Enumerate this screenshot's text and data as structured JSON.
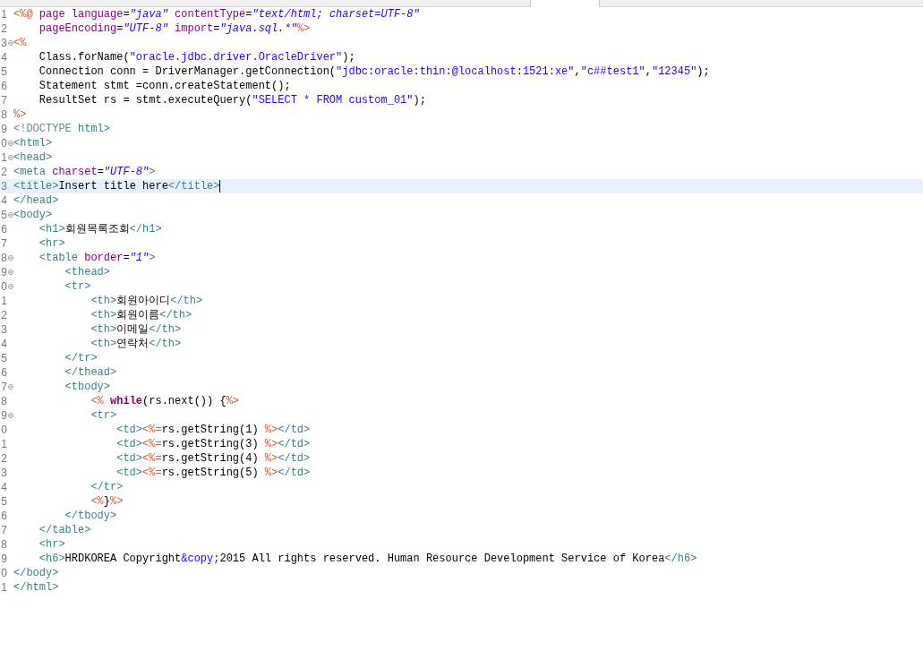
{
  "editor": {
    "lines": [
      {
        "number": "1",
        "fold": false,
        "current": false,
        "tokens": [
          {
            "kind": "jsp",
            "text": "<%@ "
          },
          {
            "kind": "attr",
            "text": "page "
          },
          {
            "kind": "attr",
            "text": "language"
          },
          {
            "kind": "text",
            "text": "="
          },
          {
            "kind": "value",
            "text": "\"java\" "
          },
          {
            "kind": "attr",
            "text": "contentType"
          },
          {
            "kind": "text",
            "text": "="
          },
          {
            "kind": "value",
            "text": "\"text/html; charset=UTF-8\""
          }
        ]
      },
      {
        "number": "2",
        "fold": false,
        "current": false,
        "tokens": [
          {
            "kind": "attr",
            "text": "    pageEncoding"
          },
          {
            "kind": "text",
            "text": "="
          },
          {
            "kind": "value",
            "text": "\"UTF-8\" "
          },
          {
            "kind": "attr",
            "text": "import"
          },
          {
            "kind": "text",
            "text": "="
          },
          {
            "kind": "value",
            "text": "\"java.sql.*\""
          },
          {
            "kind": "jsp",
            "text": "%>"
          }
        ]
      },
      {
        "number": "3",
        "fold": true,
        "current": false,
        "tokens": [
          {
            "kind": "jsp",
            "text": "<%"
          }
        ]
      },
      {
        "number": "4",
        "fold": false,
        "current": false,
        "tokens": [
          {
            "kind": "text",
            "text": "    Class.forName("
          },
          {
            "kind": "string",
            "text": "\"oracle.jdbc.driver.OracleDriver\""
          },
          {
            "kind": "text",
            "text": ");"
          }
        ]
      },
      {
        "number": "5",
        "fold": false,
        "current": false,
        "tokens": [
          {
            "kind": "text",
            "text": "    Connection conn = DriverManager.getConnection("
          },
          {
            "kind": "string",
            "text": "\"jdbc:oracle:thin:@localhost:1521:xe\""
          },
          {
            "kind": "text",
            "text": ","
          },
          {
            "kind": "string",
            "text": "\"c##test1\""
          },
          {
            "kind": "text",
            "text": ","
          },
          {
            "kind": "string",
            "text": "\"12345\""
          },
          {
            "kind": "text",
            "text": ");"
          }
        ]
      },
      {
        "number": "6",
        "fold": false,
        "current": false,
        "tokens": [
          {
            "kind": "text",
            "text": "    Statement stmt =conn.createStatement();"
          }
        ]
      },
      {
        "number": "7",
        "fold": false,
        "current": false,
        "tokens": [
          {
            "kind": "text",
            "text": "    ResultSet rs = stmt.executeQuery("
          },
          {
            "kind": "string",
            "text": "\"SELECT * FROM custom_01\""
          },
          {
            "kind": "text",
            "text": ");"
          }
        ]
      },
      {
        "number": "8",
        "fold": false,
        "current": false,
        "tokens": [
          {
            "kind": "jsp",
            "text": "%>"
          }
        ]
      },
      {
        "number": "9",
        "fold": false,
        "current": false,
        "tokens": [
          {
            "kind": "doctype",
            "text": "<!DOCTYPE"
          },
          {
            "kind": "tag",
            "text": " html>"
          }
        ]
      },
      {
        "number": "0",
        "fold": true,
        "current": false,
        "tokens": [
          {
            "kind": "tag",
            "text": "<html>"
          }
        ]
      },
      {
        "number": "1",
        "fold": true,
        "current": false,
        "tokens": [
          {
            "kind": "tag",
            "text": "<head>"
          }
        ]
      },
      {
        "number": "2",
        "fold": false,
        "current": false,
        "tokens": [
          {
            "kind": "tag",
            "text": "<meta "
          },
          {
            "kind": "attr",
            "text": "charset"
          },
          {
            "kind": "text",
            "text": "="
          },
          {
            "kind": "value",
            "text": "\"UTF-8\""
          },
          {
            "kind": "tag",
            "text": ">"
          }
        ]
      },
      {
        "number": "3",
        "fold": false,
        "current": true,
        "tokens": [
          {
            "kind": "tag",
            "text": "<title>"
          },
          {
            "kind": "text",
            "text": "Insert title here"
          },
          {
            "kind": "tag",
            "text": "</title>"
          }
        ]
      },
      {
        "number": "4",
        "fold": false,
        "current": false,
        "tokens": [
          {
            "kind": "tag",
            "text": "</head>"
          }
        ]
      },
      {
        "number": "5",
        "fold": true,
        "current": false,
        "tokens": [
          {
            "kind": "tag",
            "text": "<body>"
          }
        ]
      },
      {
        "number": "6",
        "fold": false,
        "current": false,
        "tokens": [
          {
            "kind": "tag",
            "text": "    <h1>"
          },
          {
            "kind": "text",
            "text": "회원목록조회"
          },
          {
            "kind": "tag",
            "text": "</h1>"
          }
        ]
      },
      {
        "number": "7",
        "fold": false,
        "current": false,
        "tokens": [
          {
            "kind": "tag",
            "text": "    <hr>"
          }
        ]
      },
      {
        "number": "8",
        "fold": true,
        "current": false,
        "tokens": [
          {
            "kind": "tag",
            "text": "    <table "
          },
          {
            "kind": "attr",
            "text": "border"
          },
          {
            "kind": "text",
            "text": "="
          },
          {
            "kind": "value",
            "text": "\"1\""
          },
          {
            "kind": "tag",
            "text": ">"
          }
        ]
      },
      {
        "number": "9",
        "fold": true,
        "current": false,
        "tokens": [
          {
            "kind": "tag",
            "text": "        <thead>"
          }
        ]
      },
      {
        "number": "0",
        "fold": true,
        "current": false,
        "tokens": [
          {
            "kind": "tag",
            "text": "        <tr>"
          }
        ]
      },
      {
        "number": "1",
        "fold": false,
        "current": false,
        "tokens": [
          {
            "kind": "tag",
            "text": "            <th>"
          },
          {
            "kind": "text",
            "text": "회원아이디"
          },
          {
            "kind": "tag",
            "text": "</th>"
          }
        ]
      },
      {
        "number": "2",
        "fold": false,
        "current": false,
        "tokens": [
          {
            "kind": "tag",
            "text": "            <th>"
          },
          {
            "kind": "text",
            "text": "회원이름"
          },
          {
            "kind": "tag",
            "text": "</th>"
          }
        ]
      },
      {
        "number": "3",
        "fold": false,
        "current": false,
        "tokens": [
          {
            "kind": "tag",
            "text": "            <th>"
          },
          {
            "kind": "text",
            "text": "이메일"
          },
          {
            "kind": "tag",
            "text": "</th>"
          }
        ]
      },
      {
        "number": "4",
        "fold": false,
        "current": false,
        "tokens": [
          {
            "kind": "tag",
            "text": "            <th>"
          },
          {
            "kind": "text",
            "text": "연락처"
          },
          {
            "kind": "tag",
            "text": "</th>"
          }
        ]
      },
      {
        "number": "5",
        "fold": false,
        "current": false,
        "tokens": [
          {
            "kind": "tag",
            "text": "        </tr>"
          }
        ]
      },
      {
        "number": "6",
        "fold": false,
        "current": false,
        "tokens": [
          {
            "kind": "tag",
            "text": "        </thead>"
          }
        ]
      },
      {
        "number": "7",
        "fold": true,
        "current": false,
        "tokens": [
          {
            "kind": "tag",
            "text": "        <tbody>"
          }
        ]
      },
      {
        "number": "8",
        "fold": false,
        "current": false,
        "tokens": [
          {
            "kind": "jsp",
            "text": "            <% "
          },
          {
            "kind": "keyword",
            "text": "while"
          },
          {
            "kind": "text",
            "text": "(rs.next()) {"
          },
          {
            "kind": "jsp",
            "text": "%>"
          }
        ]
      },
      {
        "number": "9",
        "fold": true,
        "current": false,
        "tokens": [
          {
            "kind": "tag",
            "text": "            <tr>"
          }
        ]
      },
      {
        "number": "0",
        "fold": false,
        "current": false,
        "tokens": [
          {
            "kind": "tag",
            "text": "                <td>"
          },
          {
            "kind": "jsp",
            "text": "<%="
          },
          {
            "kind": "text",
            "text": "rs.getString(1) "
          },
          {
            "kind": "jsp",
            "text": "%>"
          },
          {
            "kind": "tag",
            "text": "</td>"
          }
        ]
      },
      {
        "number": "1",
        "fold": false,
        "current": false,
        "tokens": [
          {
            "kind": "tag",
            "text": "                <td>"
          },
          {
            "kind": "jsp",
            "text": "<%="
          },
          {
            "kind": "text",
            "text": "rs.getString(3) "
          },
          {
            "kind": "jsp",
            "text": "%>"
          },
          {
            "kind": "tag",
            "text": "</td>"
          }
        ]
      },
      {
        "number": "2",
        "fold": false,
        "current": false,
        "tokens": [
          {
            "kind": "tag",
            "text": "                <td>"
          },
          {
            "kind": "jsp",
            "text": "<%="
          },
          {
            "kind": "text",
            "text": "rs.getString(4) "
          },
          {
            "kind": "jsp",
            "text": "%>"
          },
          {
            "kind": "tag",
            "text": "</td>"
          }
        ]
      },
      {
        "number": "3",
        "fold": false,
        "current": false,
        "tokens": [
          {
            "kind": "tag",
            "text": "                <td>"
          },
          {
            "kind": "jsp",
            "text": "<%="
          },
          {
            "kind": "text",
            "text": "rs.getString(5) "
          },
          {
            "kind": "jsp",
            "text": "%>"
          },
          {
            "kind": "tag",
            "text": "</td>"
          }
        ]
      },
      {
        "number": "4",
        "fold": false,
        "current": false,
        "tokens": [
          {
            "kind": "tag",
            "text": "            </tr>"
          }
        ]
      },
      {
        "number": "5",
        "fold": false,
        "current": false,
        "tokens": [
          {
            "kind": "jsp",
            "text": "            <%"
          },
          {
            "kind": "text",
            "text": "}"
          },
          {
            "kind": "jsp",
            "text": "%>"
          }
        ]
      },
      {
        "number": "6",
        "fold": false,
        "current": false,
        "tokens": [
          {
            "kind": "tag",
            "text": "        </tbody>"
          }
        ]
      },
      {
        "number": "7",
        "fold": false,
        "current": false,
        "tokens": [
          {
            "kind": "tag",
            "text": "    </table>"
          }
        ]
      },
      {
        "number": "8",
        "fold": false,
        "current": false,
        "tokens": [
          {
            "kind": "tag",
            "text": "    <hr>"
          }
        ]
      },
      {
        "number": "9",
        "fold": false,
        "current": false,
        "tokens": [
          {
            "kind": "tag",
            "text": "    <h6>"
          },
          {
            "kind": "text",
            "text": "HRDKOREA Copyright"
          },
          {
            "kind": "entity",
            "text": "&copy;"
          },
          {
            "kind": "text",
            "text": "2015 All rights reserved. Human Resource Development Service of Korea"
          },
          {
            "kind": "tag",
            "text": "</h6>"
          }
        ]
      },
      {
        "number": "0",
        "fold": false,
        "current": false,
        "tokens": [
          {
            "kind": "tag",
            "text": "</body>"
          }
        ]
      },
      {
        "number": "1",
        "fold": false,
        "current": false,
        "tokens": [
          {
            "kind": "tag",
            "text": "</html>"
          }
        ]
      }
    ]
  }
}
